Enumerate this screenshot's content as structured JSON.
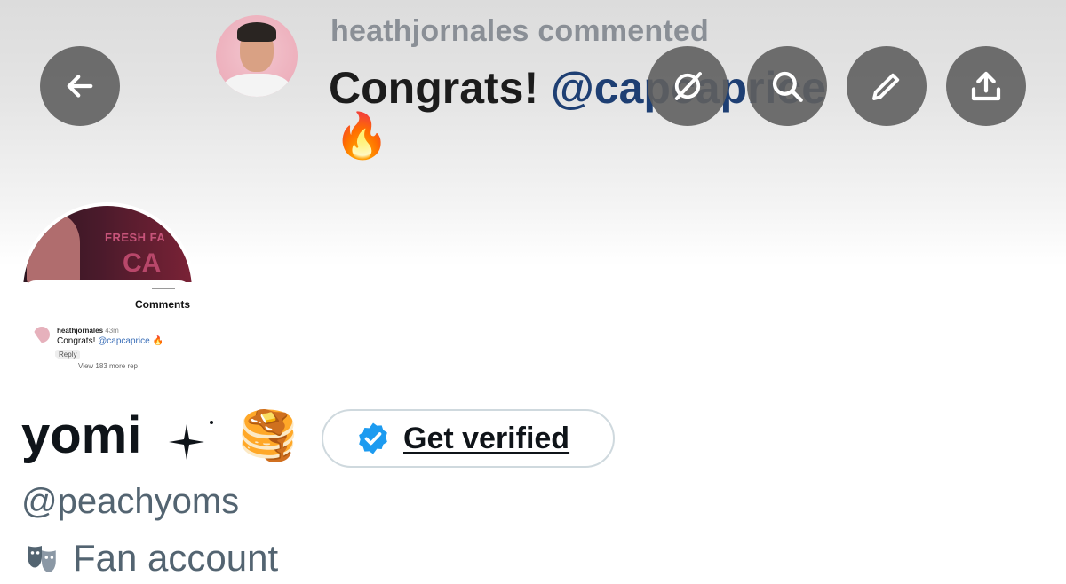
{
  "banner": {
    "username_line": "heathjornales commented",
    "comment_text": "Congrats! ",
    "comment_mention": "@capcaprice",
    "comment_emoji": "🔥"
  },
  "toolbar": {
    "back_icon": "arrow-left-icon",
    "grok_icon": "grok-icon",
    "search_icon": "search-icon",
    "edit_icon": "pencil-icon",
    "share_icon": "share-upload-icon"
  },
  "avatar_image": {
    "banner_word_1": "FRESH FA",
    "banner_word_2": "CA",
    "sheet_title": "Comments",
    "comment_user": "heathjornales",
    "comment_time": "43m",
    "comment_text": "Congrats! ",
    "comment_mention": "@capcaprice",
    "comment_emoji": "🔥",
    "reply_label": "Reply",
    "more_replies": "View 183 more rep"
  },
  "profile": {
    "display_name": "yomi",
    "name_emoji": "🥞",
    "handle": "@peachyoms",
    "category_icon": "theater-masks-icon",
    "category_label": "Fan account"
  },
  "verify": {
    "label": "Get verified",
    "icon": "verified-badge-icon",
    "badge_color": "#1d9bf0"
  },
  "colors": {
    "text_primary": "#0f1419",
    "text_secondary": "#536471",
    "button_overlay": "#5f5f5f",
    "mention": "#1e3f73"
  }
}
